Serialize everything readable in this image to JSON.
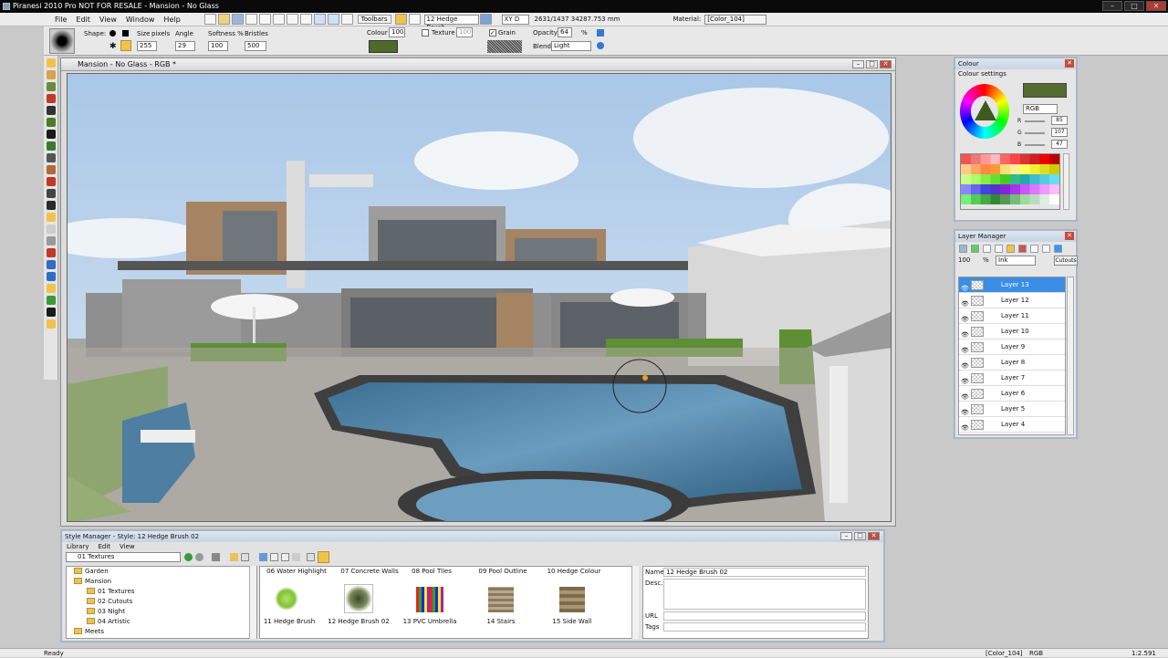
{
  "window": {
    "title": "Piranesi 2010 Pro NOT FOR RESALE - Mansion - No Glass"
  },
  "menu": [
    "File",
    "Edit",
    "View",
    "Window",
    "Help"
  ],
  "toolbar": {
    "toolbars_label": "Toolbars",
    "brush_name": "12 Hedge Brush",
    "axis_mode": "XY D",
    "coords": "2631/1437 34287.753 mm",
    "material_label": "Material:",
    "material_value": "[Color_104]"
  },
  "options": {
    "shape_label": "Shape:",
    "size_label": "Size",
    "pixels_label": "pixels",
    "angle_label": "Angle",
    "softness_label": "Softness %",
    "bristles_label": "Bristles",
    "size_value": "255",
    "angle_value": "29",
    "softness_value": "100",
    "bristles_value": "500",
    "colour_label": "Colour",
    "colour_value": "100",
    "texture_label": "Texture",
    "texture_value": "100",
    "grain_label": "Grain",
    "opacity_label": "Opacity",
    "opacity_value": "64",
    "opacity_unit": "%",
    "blend_label": "Blend",
    "blend_value": "Light",
    "brush_colour": "#4f6a2a"
  },
  "document": {
    "title": "Mansion - No Glass - RGB *"
  },
  "colour_panel": {
    "title": "Colour",
    "settings_label": "Colour settings",
    "mode": "RGB",
    "r_label": "R",
    "r_value": "85",
    "g_label": "G",
    "g_value": "107",
    "b_label": "B",
    "b_value": "47",
    "current_colour": "#556b2f"
  },
  "layer_panel": {
    "title": "Layer Manager",
    "opacity": "100",
    "opacity_unit": "%",
    "blend": "Ink",
    "cutouts_button": "Cutouts",
    "layers": [
      "Layer 13",
      "Layer 12",
      "Layer 11",
      "Layer 10",
      "Layer 9",
      "Layer 8",
      "Layer 7",
      "Layer 6",
      "Layer 5",
      "Layer 4"
    ],
    "selected": "Layer 13"
  },
  "style_manager": {
    "title": "Style Manager - Style: 12 Hedge Brush 02",
    "menu": [
      "Library",
      "Edit",
      "View"
    ],
    "folder_select": "01 Textures",
    "tree": [
      {
        "label": "Garden",
        "indent": 0
      },
      {
        "label": "Mansion",
        "indent": 0
      },
      {
        "label": "01 Textures",
        "indent": 1
      },
      {
        "label": "02 Cutouts",
        "indent": 1
      },
      {
        "label": "03 Night",
        "indent": 1
      },
      {
        "label": "04 Artistic",
        "indent": 1
      },
      {
        "label": "Meets",
        "indent": 0
      }
    ],
    "top_tiles": [
      "06 Water Highlight",
      "07 Concrete Walls",
      "08 Pool Tiles",
      "09 Pool Outline",
      "10 Hedge Colour"
    ],
    "bottom_tiles": [
      "11 Hedge Brush",
      "12 Hedge Brush 02",
      "13 PVC Umbrella",
      "14 Stairs",
      "15 Side Wall"
    ],
    "name_label": "Name",
    "name_value": "12 Hedge Brush 02",
    "desc_label": "Desc.",
    "url_label": "URL",
    "tags_label": "Tags"
  },
  "status": {
    "left": "Ready",
    "material": "[Color_104]",
    "mode": "RGB",
    "zoom": "1:2.591"
  }
}
